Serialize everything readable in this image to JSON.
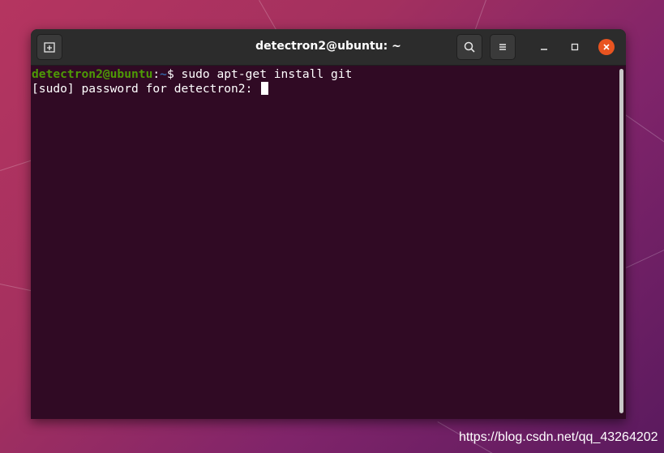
{
  "window": {
    "title": "detectron2@ubuntu: ~"
  },
  "headerbar": {
    "new_tab_icon": "new-tab-icon",
    "search_icon": "search-icon",
    "menu_icon": "hamburger-menu-icon",
    "minimize_icon": "minimize-icon",
    "maximize_icon": "maximize-icon",
    "close_icon": "close-icon"
  },
  "terminal": {
    "line1": {
      "user_host": "detectron2@ubuntu",
      "separator": ":",
      "path": "~",
      "symbol": "$",
      "command": " sudo apt-get install git"
    },
    "line2": {
      "text": "[sudo] password for detectron2: "
    }
  },
  "watermark": "https://blog.csdn.net/qq_43264202",
  "colors": {
    "terminal_bg": "#300a24",
    "prompt_user": "#4e9a06",
    "prompt_path": "#3465a4",
    "close_button": "#e95420",
    "headerbar_bg": "#2c2c2c"
  }
}
